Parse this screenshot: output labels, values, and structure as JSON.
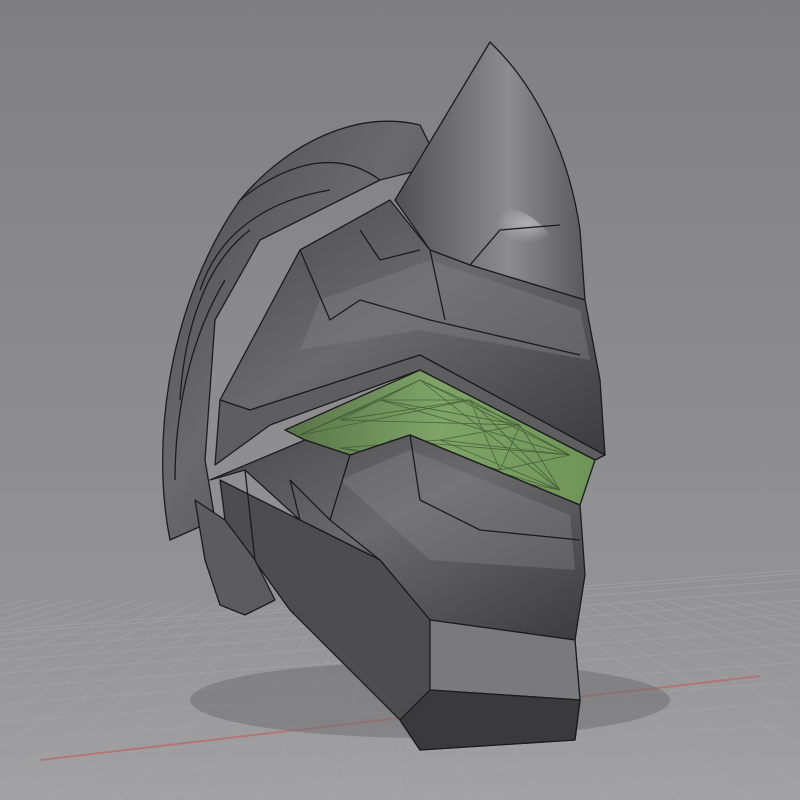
{
  "scene": {
    "subject": "helmet-model",
    "colors": {
      "background_top": "#838385",
      "background_bottom": "#9a9a9c",
      "grid_line": "#a9a9ab",
      "axis_red": "#b8696a",
      "shell_dark": "#3a3a3c",
      "shell_mid": "#5a5a5c",
      "shell_light": "#8a8a8c",
      "visor_green": "#6f8f5a",
      "visor_green_light": "#9bbb83",
      "wireframe": "#1c1c1e"
    }
  }
}
